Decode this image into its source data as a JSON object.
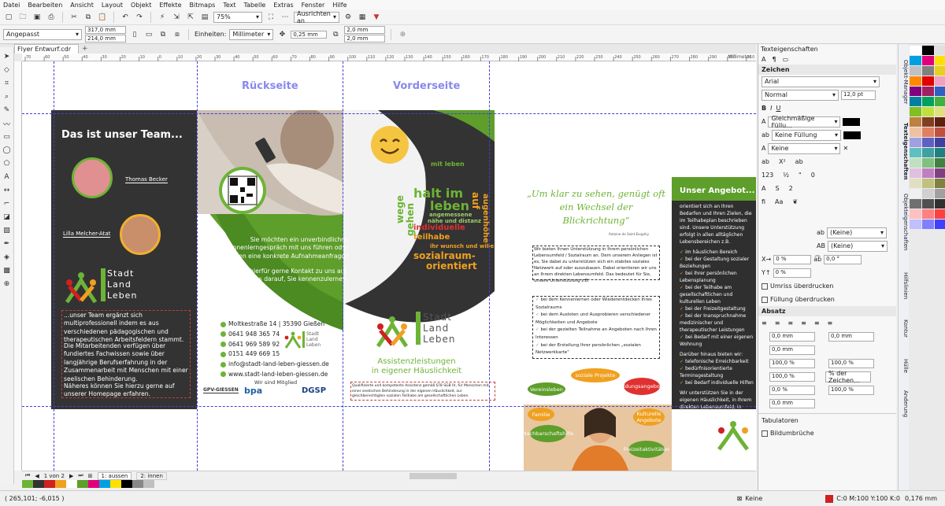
{
  "menu": [
    "Datei",
    "Bearbeiten",
    "Ansicht",
    "Layout",
    "Objekt",
    "Effekte",
    "Bitmaps",
    "Text",
    "Tabelle",
    "Extras",
    "Fenster",
    "Hilfe"
  ],
  "toolbar1": {
    "zoom": "75%",
    "align": "Ausrichten an"
  },
  "toolbar2": {
    "preset": "Angepasst",
    "width": "317,0 mm",
    "height": "214,0 mm",
    "units_label": "Einheiten:",
    "units": "Millimeter",
    "nudge": "0,25 mm",
    "dup_x": "2,0 mm",
    "dup_y": "2,0 mm"
  },
  "document": {
    "tab": "Flyer Entwurf.cdr"
  },
  "ruler": {
    "ticks": [
      "70",
      "60",
      "50",
      "40",
      "30",
      "20",
      "10",
      "0",
      "10",
      "20",
      "30",
      "40",
      "50",
      "60",
      "70",
      "80",
      "90",
      "100",
      "110",
      "120",
      "130",
      "140",
      "150",
      "160",
      "170",
      "180",
      "190",
      "200",
      "210",
      "220",
      "230",
      "240",
      "250",
      "260",
      "270",
      "280",
      "290",
      "300",
      "310"
    ],
    "unit": "Millimeter"
  },
  "panel": {
    "title": "Texteigenschaften",
    "zeichen": "Zeichen",
    "font": "Arial",
    "style": "Normal",
    "size": "12,0 pt",
    "fill": "Gleichmäßige Füllu...",
    "bg_fill": "Keine Füllung",
    "outline": "Keine",
    "ot1": "(Keine)",
    "ot2": "(Keine)",
    "spacing1": "0 %",
    "spacing2": "0,0 °",
    "spacing3": "0 %",
    "umriss": "Umriss überdrucken",
    "fuellung": "Füllung überdrucken",
    "absatz": "Absatz",
    "a1": "0,0 mm",
    "a2": "0,0 mm",
    "a3": "0,0 mm",
    "a4": "0,0 mm",
    "b1": "100,0 %",
    "b2": "100,0 %",
    "b3": "100,0 %",
    "b4": "% der Zeichen...",
    "b5": "0,0 %",
    "b6": "100,0 %",
    "tabulatoren": "Tabulatoren",
    "bildumbruch": "Bildumbrüche"
  },
  "side_tabs": [
    "Objekt-Manager",
    "Texteigenschaften",
    "Objekteigenschaften",
    "Hilfslinien",
    "Kontur",
    "Hülle",
    "Änderung"
  ],
  "pages": {
    "nav": "1 von 2",
    "p1": "1: aussen",
    "p2": "2: innen"
  },
  "status": {
    "coords": "( 265,101; -6,015 )",
    "fill_label": "Keine",
    "color_info": "C:0 M:100 Y:100 K:0",
    "outline": "0,176 mm"
  },
  "flyer": {
    "label_back": "Rückseite",
    "label_front": "Vorderseite",
    "team_heading": "Das ist unser Team...",
    "person1": "Thomas Becker",
    "person2": "Lilla Melcher-Atat",
    "logo_lines": [
      "Stadt",
      "Land",
      "Leben"
    ],
    "team_text_1": "...unser Team ergänzt sich multiprofessionell indem es aus verschiedenen pädagogischen und therapeutischen Arbeitsfeldern stammt.",
    "team_text_2": "Die Mitarbeitenden verfügen über fundiertes Fachwissen sowie über langjährige Berufserfahrung in der Zusammenarbeit mit Menschen mit einer seelischen Behinderung.",
    "team_text_3": "Näheres können Sie hierzu gerne auf unserer Homepage erfahren.",
    "mid_text_1": "Sie möchten ein unverbindliches Kennenlerngespräch mit uns führen oder haben eine konkrete Aufnahmeanfrage?",
    "mid_text_2": "Nehmen Sie hierfür gerne Kontakt zu uns auf. Wir freuen uns darauf, Sie kennenzulernen.",
    "contact": [
      "Moltkestraße 14 | 35390 Gießen",
      "0641 948 365 74",
      "0641 969 589 92",
      "0151 449 669 15",
      "info@stadt-land-leben-giessen.de",
      "www.stadt-land-leben-giessen.de"
    ],
    "member": "Wir sind Mitglied",
    "member_logos": [
      "GPV-GIESSEN",
      "bpa",
      "DGSP"
    ],
    "assist_line1": "Assistenzleistungen",
    "assist_line2": "in eigener Häuslichkeit",
    "legal": "Qualifizierte und kompetente Assistenz gemäß §78 SGB IX, für Menschen mit einer seelischen Behinderung in der eigenen Häuslichkeit, zur gleichberechtigten sozialen Teilhabe am gesellschaftlichen Leben.",
    "wordcloud": [
      "mit leben",
      "halt im",
      "leben",
      "auf",
      "augenhöhe",
      "angemessene",
      "nähe und distanz",
      "individuelle",
      "teilhabe",
      "ihr wunsch und wille",
      "sozialraum-",
      "orientiert",
      "wege",
      "gehen"
    ],
    "quote": "„Um klar zu sehen, genügt oft ein Wechsel der Blickrichtung“",
    "quote_author": "Antoine de Saint-Exupéry",
    "intro": "Wir bieten Ihnen Unterstützung in Ihrem persönlichen Lebensumfeld / Sozialraum an. Dem unserem Anliegen ist es, Sie dabei zu unterstützen sich ein stabiles soziales Netzwerk auf oder auszubauen. Dabei orientieren wir uns an Ihrem direkten Lebensumfeld. Das bedeutet für Sie, unsere Unterstützung z.B.",
    "checks": [
      "bei dem Kennenlernen oder Wiederentdecken Ihres Sozialraums",
      "bei dem Ausloten und Ausprobieren verschiedener Möglichkeiten und Angebote",
      "bei der gezielten Teilnahme an Angeboten nach Ihren Interessen",
      "bei der Erstellung Ihrer persönlichen „sozialen Netzwerkkarte“"
    ],
    "angebot_head": "Unser Angebot...",
    "angebot_intro": "orientiert sich an Ihren Bedarfen und Ihren Zielen, die im Teilhabeplan beschrieben sind. Unsere Unterstützung erfolgt in allen alltäglichen Lebensbereichen z.B.",
    "angebot_items": [
      "im häuslichen Bereich",
      "bei der Gestaltung sozialer Beziehungen",
      "bei Ihrer persönlichen Lebensplanung",
      "bei der Teilhabe am gesellschaftlichen und kulturellen Leben",
      "bei der Freizeitgestaltung",
      "bei der Inanspruchnahme medizinischer und therapeutischer Leistungen",
      "bei Bedarf mit einer eigenen Wohnung"
    ],
    "angebot_more": "Darüber hinaus bieten wir:",
    "angebot_more_items": [
      "telefonische Erreichbarkeit",
      "bedürfnisorientierte Terminsgestaltung",
      "bei Bedarf individuelle Hilfen"
    ],
    "angebot_outro": "Wir unterstützen Sie in der eigenen Häuslichkeit, in Ihrem direkten Lebensumfeld, in einem persönlichen vertrauensvollen und hellen Rahmen bei der Suche nach Ihren Zielen.",
    "bubbles": [
      "soziale Projekte",
      "Vereinsleben",
      "Bildungsangebote",
      "Familie",
      "Kulturelle Angebote",
      "Nachbarschaftshilfe",
      "Freizeitaktivitäten"
    ]
  },
  "colors": {
    "green": "#6db336",
    "darkgray": "#333333",
    "red": "#d02020",
    "orange": "#f0a020",
    "blue_guide": "#4040d0"
  }
}
